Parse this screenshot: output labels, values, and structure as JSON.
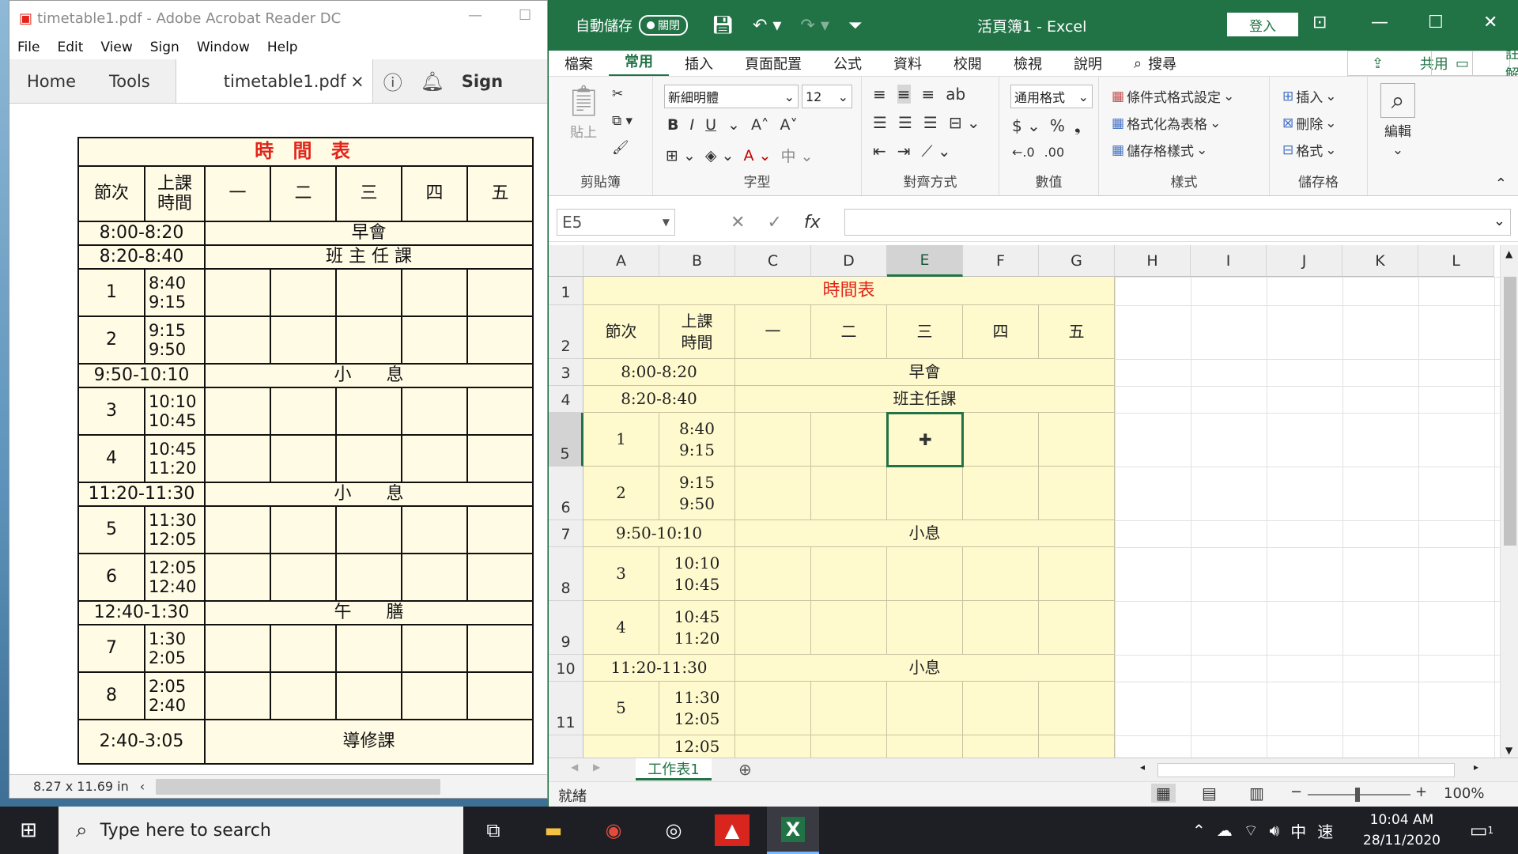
{
  "acrobat": {
    "title": "timetable1.pdf - Adobe Acrobat Reader DC",
    "menu": [
      "File",
      "Edit",
      "View",
      "Sign",
      "Window",
      "Help"
    ],
    "tabs": {
      "home": "Home",
      "tools": "Tools",
      "doc": "timetable1.pdf",
      "close": "×",
      "sign": "Sign"
    },
    "status_size": "8.27 x 11.69 in",
    "pdf": {
      "title": "時 間 表",
      "h_period": "節次",
      "h_time": "上課\n時間",
      "days": [
        "一",
        "二",
        "三",
        "四",
        "五"
      ],
      "r_morning_time": "8:00-8:20",
      "r_morning": "早會",
      "r_homeroom_time": "8:20-8:40",
      "r_homeroom": "班 主 任 課",
      "p1": "1",
      "p1_t": "8:40\n9:15",
      "p2": "2",
      "p2_t": "9:15\n9:50",
      "break1_time": "9:50-10:10",
      "break1": "小　　息",
      "p3": "3",
      "p3_t": "10:10\n10:45",
      "p4": "4",
      "p4_t": "10:45\n11:20",
      "break2_time": "11:20-11:30",
      "break2": "小　　息",
      "p5": "5",
      "p5_t": "11:30\n12:05",
      "p6": "6",
      "p6_t": "12:05\n12:40",
      "lunch_time": "12:40-1:30",
      "lunch": "午　　膳",
      "p7": "7",
      "p7_t": "1:30\n2:05",
      "p8": "8",
      "p8_t": "2:05\n2:40",
      "tutor_time": "2:40-3:05",
      "tutor": "導修課"
    }
  },
  "excel": {
    "autosave": "自動儲存",
    "autosave_state": "關閉",
    "doc_title": "活頁簿1  -  Excel",
    "login": "登入",
    "tabs": [
      "檔案",
      "常用",
      "插入",
      "頁面配置",
      "公式",
      "資料",
      "校閱",
      "檢視",
      "說明"
    ],
    "search": "搜尋",
    "share": "共用",
    "comments": "註解",
    "ribbon": {
      "clipboard": "剪貼簿",
      "paste": "貼上",
      "font_group": "字型",
      "font_name": "新細明體",
      "font_size": "12",
      "align_group": "對齊方式",
      "number_group": "數值",
      "number_format": "通用格式",
      "styles_group": "樣式",
      "cond_format": "條件式格式設定",
      "format_table": "格式化為表格",
      "cell_styles": "儲存格樣式",
      "cells_group": "儲存格",
      "insert": "插入",
      "delete": "刪除",
      "format": "格式",
      "edit": "編輯"
    },
    "name_box": "E5",
    "columns": [
      "A",
      "B",
      "C",
      "D",
      "E",
      "F",
      "G",
      "H",
      "I",
      "J",
      "K",
      "L"
    ],
    "rows": [
      "1",
      "2",
      "3",
      "4",
      "5",
      "6",
      "7",
      "8",
      "9",
      "10",
      "11"
    ],
    "sheet": {
      "title": "時間表",
      "h_period": "節次",
      "h_time": "上課\n時間",
      "days": [
        "一",
        "二",
        "三",
        "四",
        "五"
      ],
      "r3_time": "8:00-8:20",
      "r3": "早會",
      "r4_time": "8:20-8:40",
      "r4": "班主任課",
      "r5_p": "1",
      "r5_t": "8:40\n9:15",
      "r6_p": "2",
      "r6_t": "9:15\n9:50",
      "r7_time": "9:50-10:10",
      "r7": "小息",
      "r8_p": "3",
      "r8_t": "10:10\n10:45",
      "r9_p": "4",
      "r9_t": "10:45\n11:20",
      "r10_time": "11:20-11:30",
      "r10": "小息",
      "r11_p": "5",
      "r11_t": "11:30\n12:05",
      "r12_t": "12:05"
    },
    "sheet_tab": "工作表1",
    "status": "就緒",
    "zoom": "100%"
  },
  "taskbar": {
    "search": "Type here to search",
    "time": "10:04 AM",
    "date": "28/11/2020",
    "ime": "中",
    "ime2": "速",
    "notif": "1"
  }
}
